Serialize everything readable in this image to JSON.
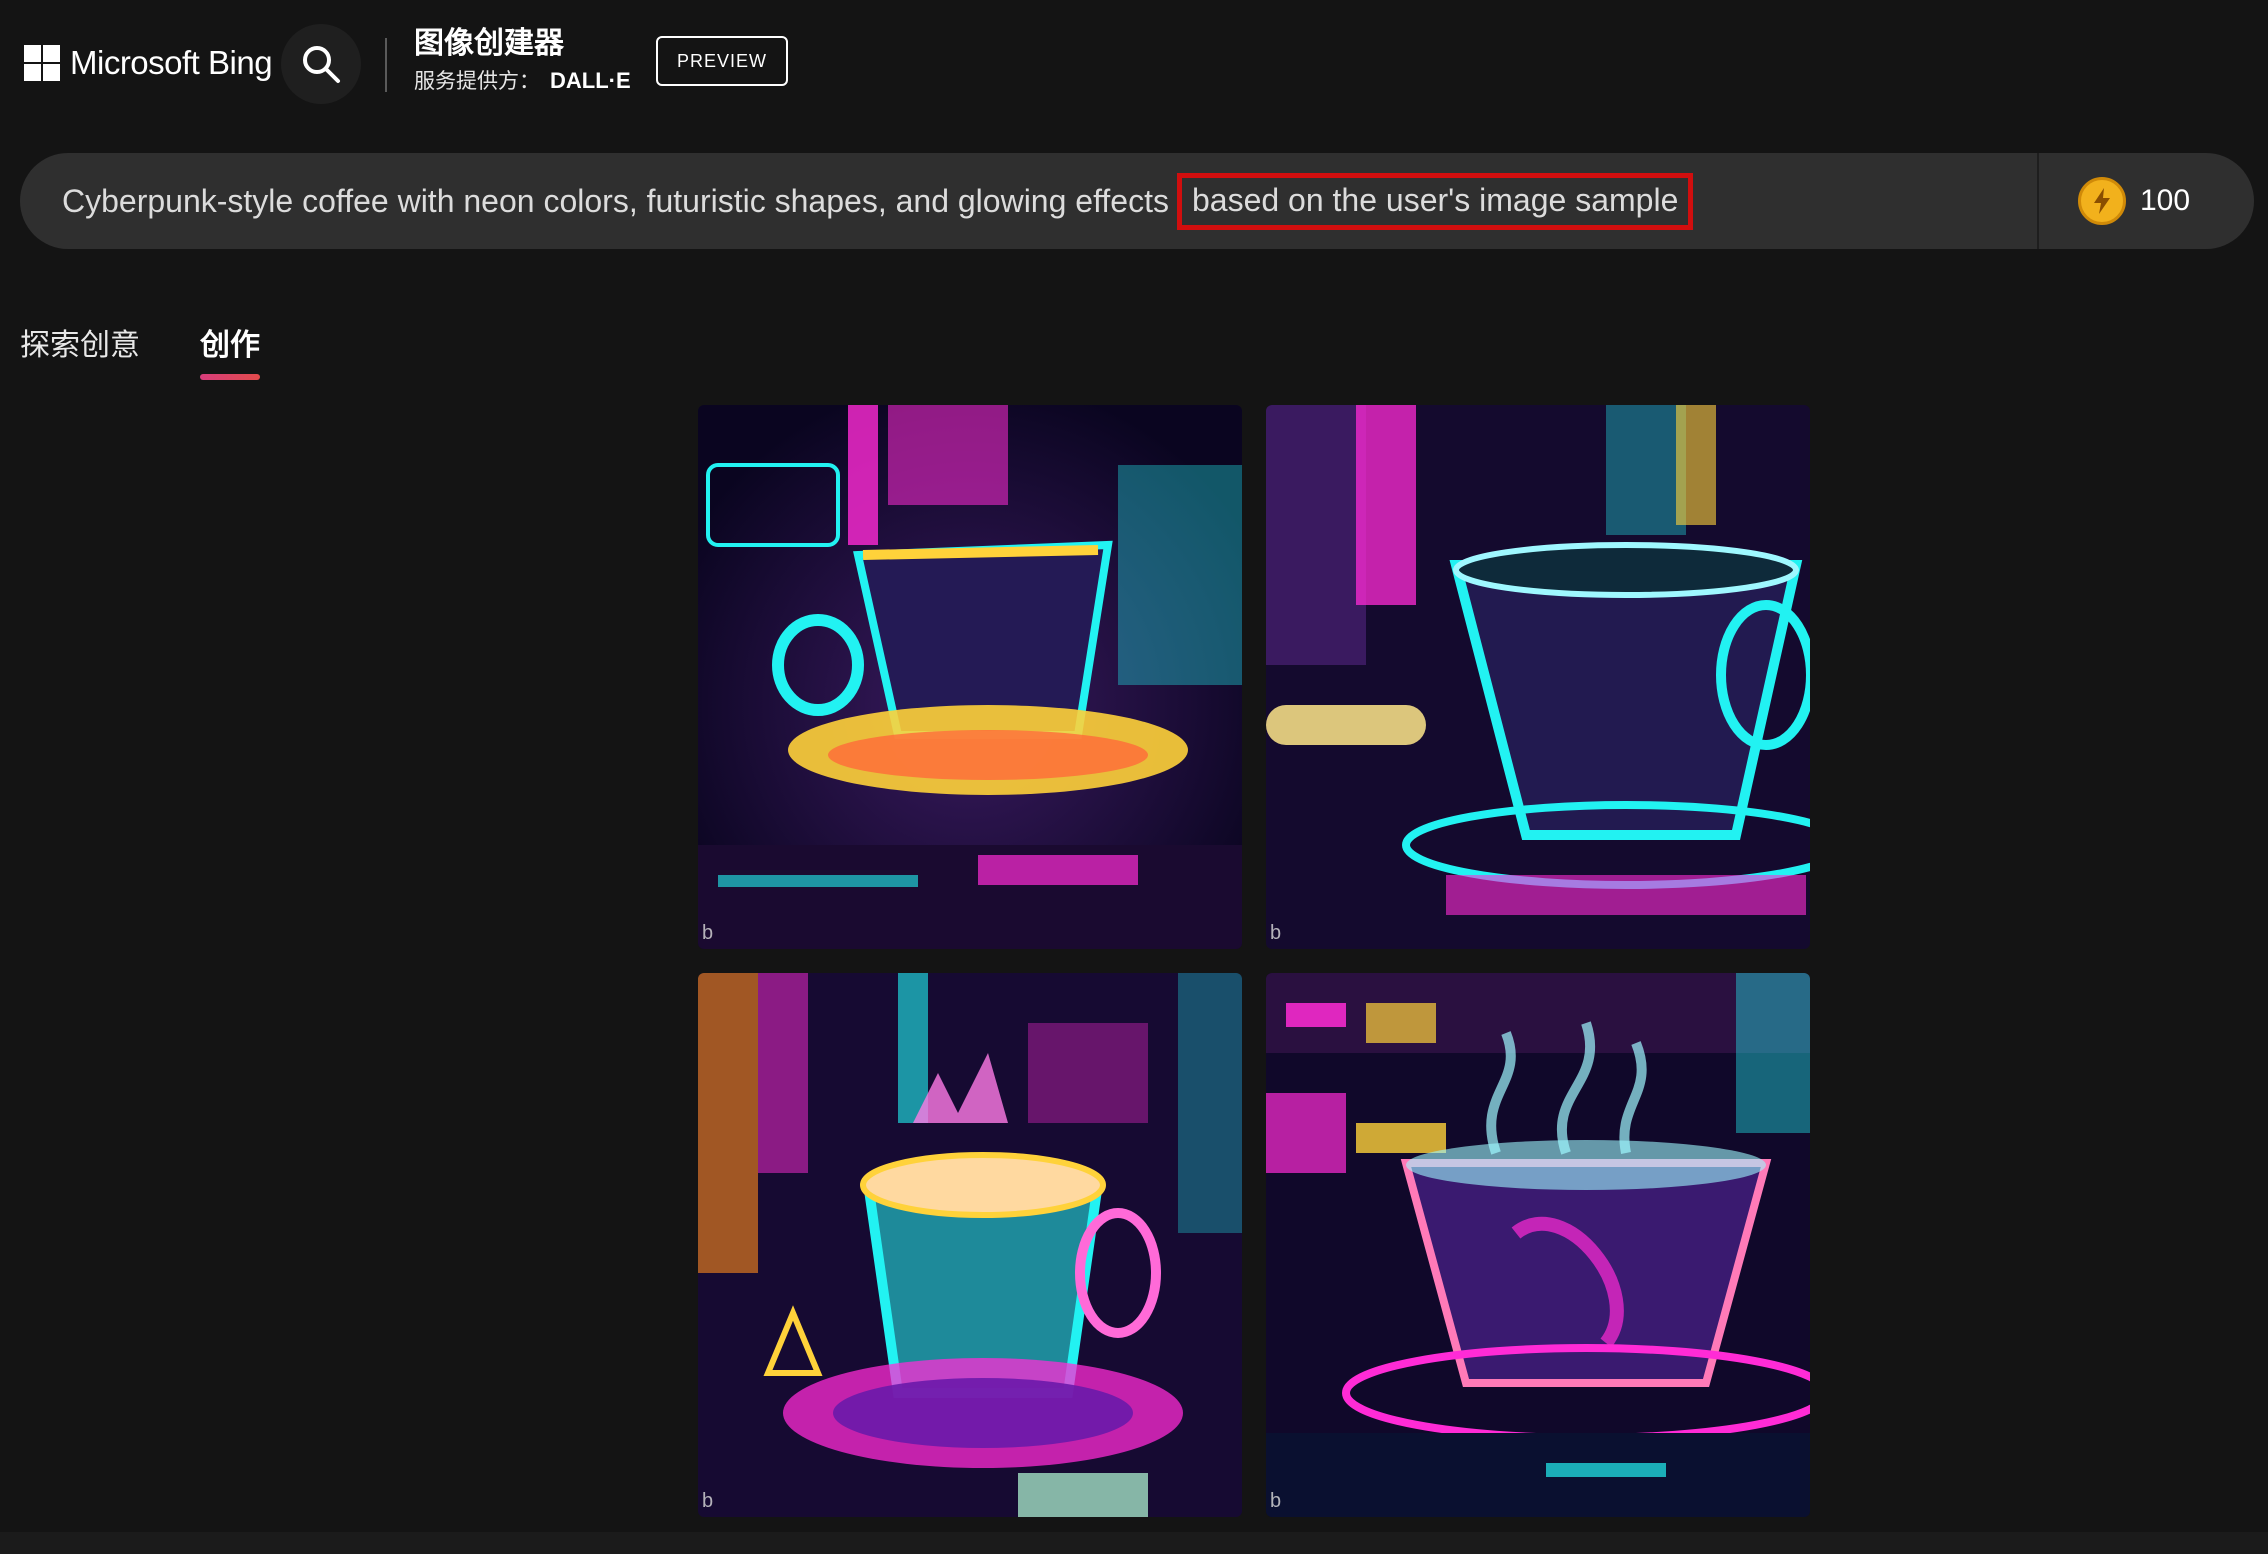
{
  "header": {
    "logo_text": "Microsoft Bing",
    "app_title": "图像创建器",
    "provider_label": "服务提供方：",
    "provider_name": "DALL·E",
    "preview_label": "PREVIEW"
  },
  "prompt": {
    "text": "Cyberpunk-style coffee with neon colors, futuristic shapes, and glowing effects",
    "highlighted_text": "based on the user's image sample",
    "highlight_color": "#d10e0e"
  },
  "boosts": {
    "icon": "lightning-coin-icon",
    "count": "100"
  },
  "tabs": [
    {
      "label": "探索创意",
      "active": false
    },
    {
      "label": "创作",
      "active": true
    }
  ],
  "images": [
    {
      "name": "neon-coffee-image-1",
      "watermark": "b"
    },
    {
      "name": "neon-coffee-image-2",
      "watermark": "b"
    },
    {
      "name": "neon-coffee-image-3",
      "watermark": "b"
    },
    {
      "name": "neon-coffee-image-4",
      "watermark": "b"
    }
  ],
  "colors": {
    "background": "#141414",
    "prompt_bar": "#2f2f2f",
    "tab_underline": "#d83d7c",
    "neon_cyan": "#22f2f2",
    "neon_magenta": "#ff2bd6",
    "neon_yellow": "#ffd23a"
  }
}
